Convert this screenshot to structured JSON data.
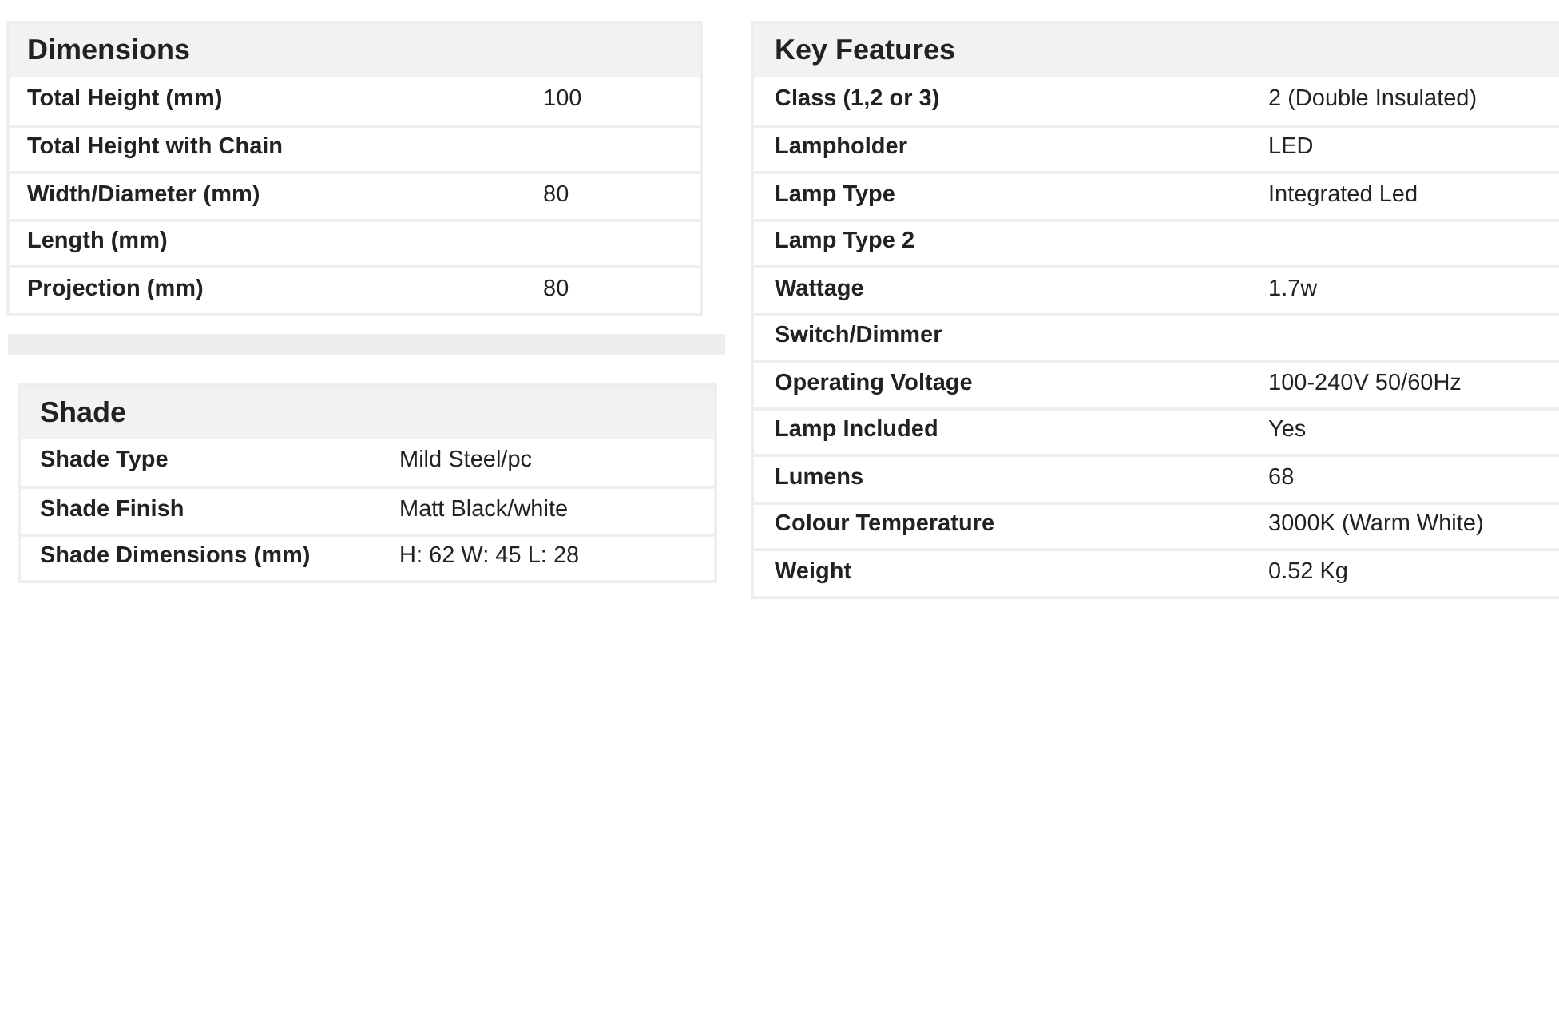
{
  "dimensions": {
    "title": "Dimensions",
    "rows": [
      {
        "label": "Total Height (mm)",
        "value": "100"
      },
      {
        "label": "Total Height with Chain"
      },
      {
        "label": "Width/Diameter (mm)",
        "value": "80"
      },
      {
        "label": "Length (mm)"
      },
      {
        "label": "Projection (mm)",
        "value": "80"
      }
    ]
  },
  "shade": {
    "title": "Shade",
    "rows": [
      {
        "label": "Shade Type",
        "value": "Mild Steel/pc"
      },
      {
        "label": "Shade Finish",
        "value": "Matt Black/white"
      },
      {
        "label": "Shade Dimensions (mm)",
        "value": "H: 62 W: 45 L: 28"
      }
    ]
  },
  "key_features": {
    "title": "Key Features",
    "rows": [
      {
        "label": "Class (1,2 or 3)",
        "value": "2 (Double Insulated)"
      },
      {
        "label": "Lampholder",
        "value": "LED"
      },
      {
        "label": "Lamp Type",
        "value": "Integrated Led"
      },
      {
        "label": "Lamp Type 2"
      },
      {
        "label": "Wattage",
        "value": "1.7w"
      },
      {
        "label": "Switch/Dimmer"
      },
      {
        "label": "Operating Voltage",
        "value": "100-240V 50/60Hz"
      },
      {
        "label": "Lamp Included",
        "value": "Yes"
      },
      {
        "label": "Lumens",
        "value": "68"
      },
      {
        "label": "Colour Temperature",
        "value": "3000K (Warm White)"
      },
      {
        "label": "Weight",
        "value": "0.52 Kg"
      }
    ]
  }
}
